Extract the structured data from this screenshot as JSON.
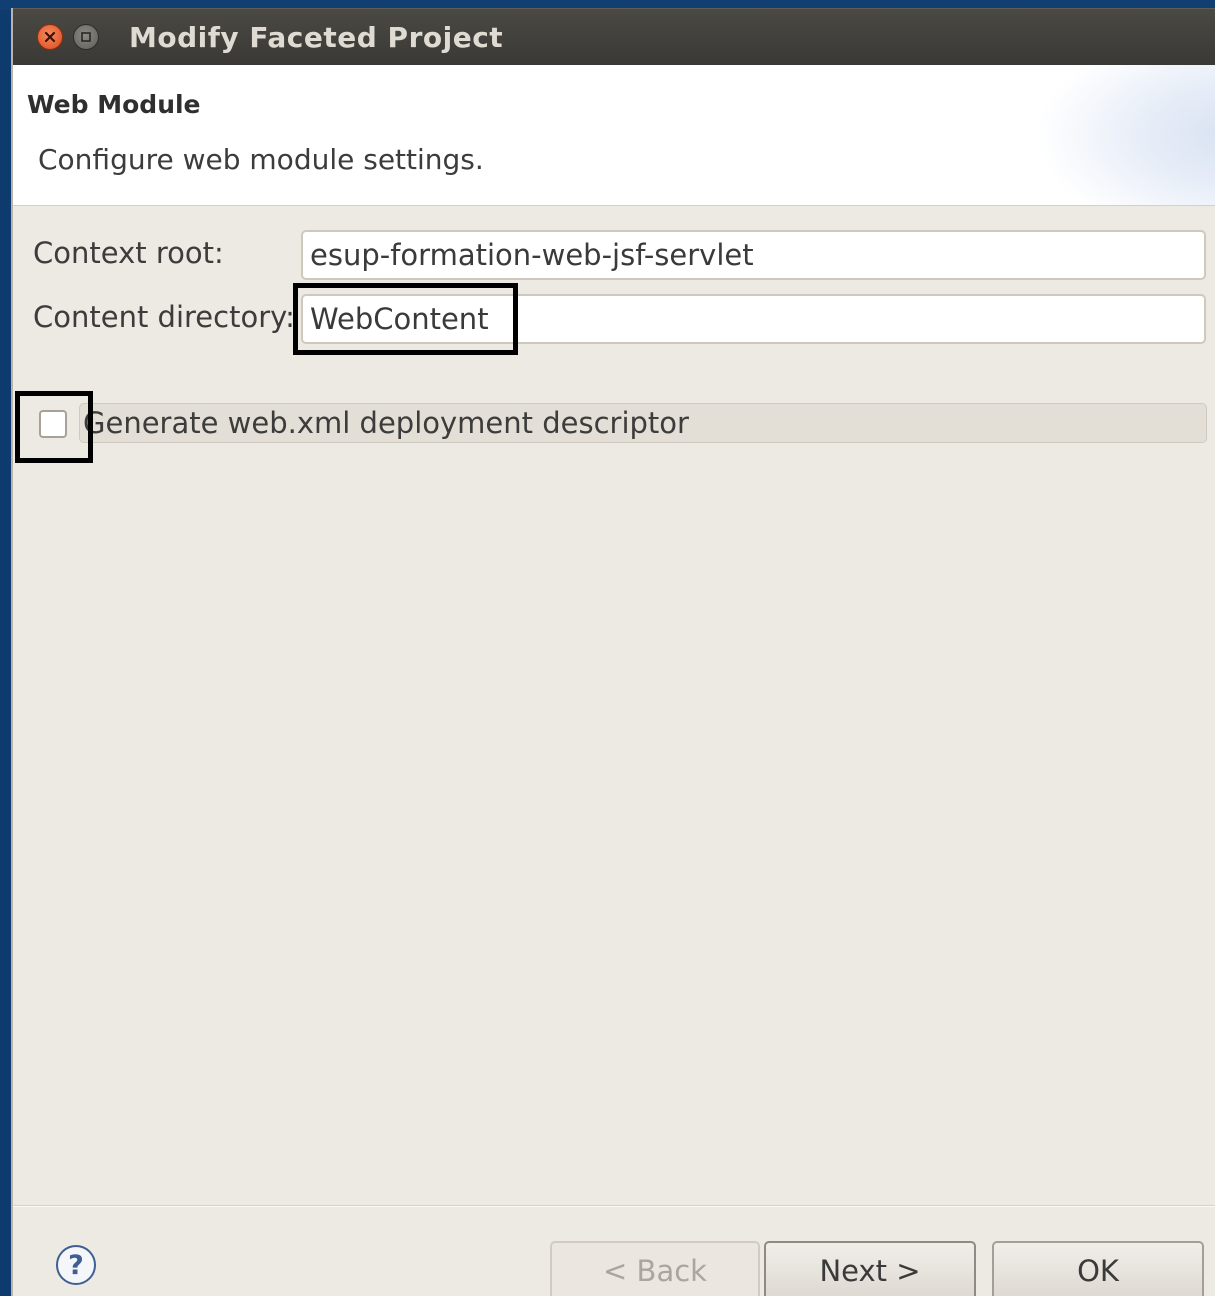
{
  "window": {
    "title": "Modify Faceted Project"
  },
  "banner": {
    "title": "Web Module",
    "description": "Configure web module settings."
  },
  "form": {
    "context_root": {
      "label": "Context root:",
      "value": "esup-formation-web-jsf-servlet"
    },
    "content_directory": {
      "label": "Content directory:",
      "value": "WebContent"
    },
    "generate_descriptor": {
      "label": "Generate web.xml deployment descriptor",
      "checked": false
    }
  },
  "buttons": {
    "help": "?",
    "back": "< Back",
    "next": "Next >",
    "ok": "OK"
  },
  "icons": {
    "close": "close-icon",
    "minimize": "minimize-icon",
    "help": "help-icon"
  }
}
